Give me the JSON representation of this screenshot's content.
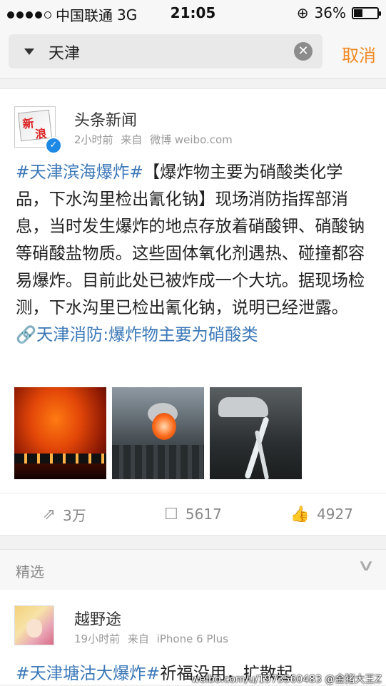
{
  "status_bar": {
    "carrier": "中国联通",
    "network": "3G",
    "time": "21:05",
    "battery": "36%",
    "battery_level": 0.36
  },
  "search": {
    "query": "天津",
    "clear_icon": "clear-icon",
    "cancel_label": "取消"
  },
  "post": {
    "author": "头条新闻",
    "time": "2小时前",
    "source_prefix": "来自",
    "source": "微博 weibo.com",
    "hashtag": "#天津滨海爆炸#",
    "body": "【爆炸物主要为硝酸类化学品，下水沟里检出氰化钠】现场消防指挥部消息，当时发生爆炸的地点存放着硝酸钾、硝酸钠等硝酸盐物质。这些固体氧化剂遇热、碰撞都容易爆炸。目前此处已被炸成一个大坑。据现场检测，下水沟里已检出氰化钠，说明已经泄露。",
    "link_text": "天津消防:爆炸物主要为硝酸类",
    "images": [
      "fire-night-photo",
      "explosion-smoke-photo",
      "cracked-ground-photo"
    ],
    "repost_count": "3万",
    "comment_count": "5617",
    "like_count": "4927"
  },
  "featured_section": {
    "label": "精选"
  },
  "post2": {
    "author": "越野途",
    "time": "19小时前",
    "source_prefix": "来自",
    "source": "iPhone 6 Plus",
    "hashtag": "#天津塘沽大爆炸#",
    "body": "祈福没用，扩散起",
    "watermark": "weibo.com/u/1973560483  @金猪大王Z"
  },
  "colors": {
    "accent_orange": "#f08a24",
    "link_blue": "#3b78b8",
    "verified_blue": "#1e88e5"
  }
}
